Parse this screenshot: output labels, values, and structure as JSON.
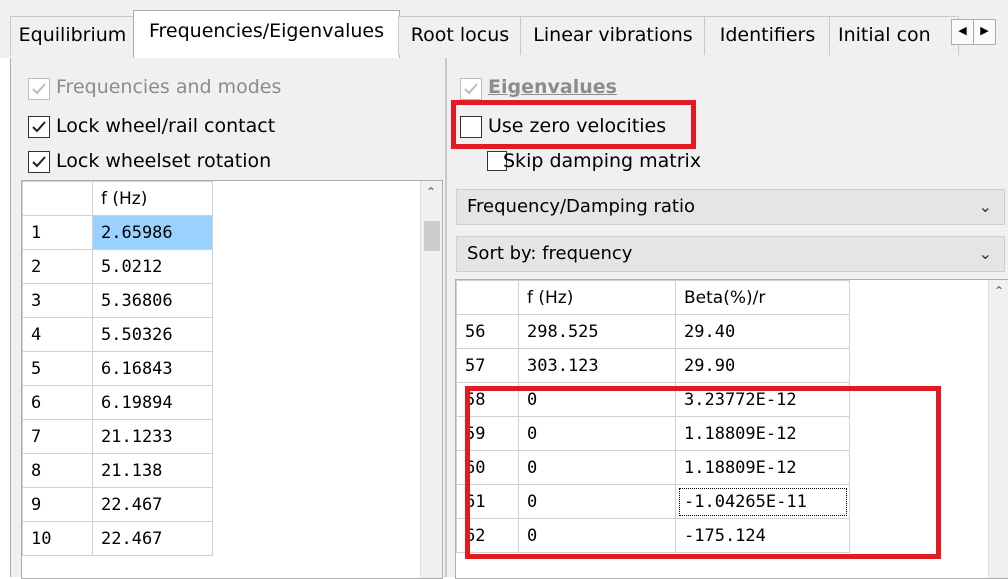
{
  "tabs": [
    {
      "label": "Equilibrium",
      "active": false
    },
    {
      "label": "Frequencies/Eigenvalues",
      "active": true
    },
    {
      "label": "Root locus",
      "active": false
    },
    {
      "label": "Linear vibrations",
      "active": false
    },
    {
      "label": "Identifiers",
      "active": false
    },
    {
      "label": "Initial con",
      "active": false
    }
  ],
  "tab_scroll": {
    "left_icon": "arrow-left-icon",
    "right_icon": "arrow-right-icon"
  },
  "left": {
    "freq_modes_label": "Frequencies and modes",
    "freq_modes_checked": true,
    "lock_contact_label": "Lock wheel/rail contact",
    "lock_contact_checked": true,
    "lock_rotation_label": "Lock wheelset rotation",
    "lock_rotation_checked": true,
    "grid": {
      "header": "f (Hz)",
      "rows": [
        {
          "n": "1",
          "f": "2.65986"
        },
        {
          "n": "2",
          "f": "5.0212"
        },
        {
          "n": "3",
          "f": "5.36806"
        },
        {
          "n": "4",
          "f": "5.50326"
        },
        {
          "n": "5",
          "f": "6.16843"
        },
        {
          "n": "6",
          "f": "6.19894"
        },
        {
          "n": "7",
          "f": "21.1233"
        },
        {
          "n": "8",
          "f": "21.138"
        },
        {
          "n": "9",
          "f": "22.467"
        },
        {
          "n": "10",
          "f": "22.467"
        }
      ]
    }
  },
  "right": {
    "eigen_label": "Eigenvalues",
    "eigen_checked": true,
    "zero_vel_label": "Use zero velocities",
    "zero_vel_checked": false,
    "skip_damp_label": "Skip damping matrix",
    "skip_damp_checked": false,
    "combo1": "Frequency/Damping ratio",
    "combo2": "Sort by: frequency",
    "grid": {
      "headers": [
        "f (Hz)",
        "Beta(%)/r"
      ],
      "rows": [
        {
          "n": "56",
          "f": "298.525",
          "b": "29.40"
        },
        {
          "n": "57",
          "f": "303.123",
          "b": "29.90"
        },
        {
          "n": "58",
          "f": "0",
          "b": "3.23772E-12"
        },
        {
          "n": "59",
          "f": "0",
          "b": "1.18809E-12"
        },
        {
          "n": "60",
          "f": "0",
          "b": "1.18809E-12"
        },
        {
          "n": "61",
          "f": "0",
          "b": "-1.04265E-11"
        },
        {
          "n": "62",
          "f": "0",
          "b": "-175.124"
        }
      ]
    }
  },
  "colors": {
    "highlight_red": "#e21b23",
    "selected_cell": "#99d1ff"
  }
}
